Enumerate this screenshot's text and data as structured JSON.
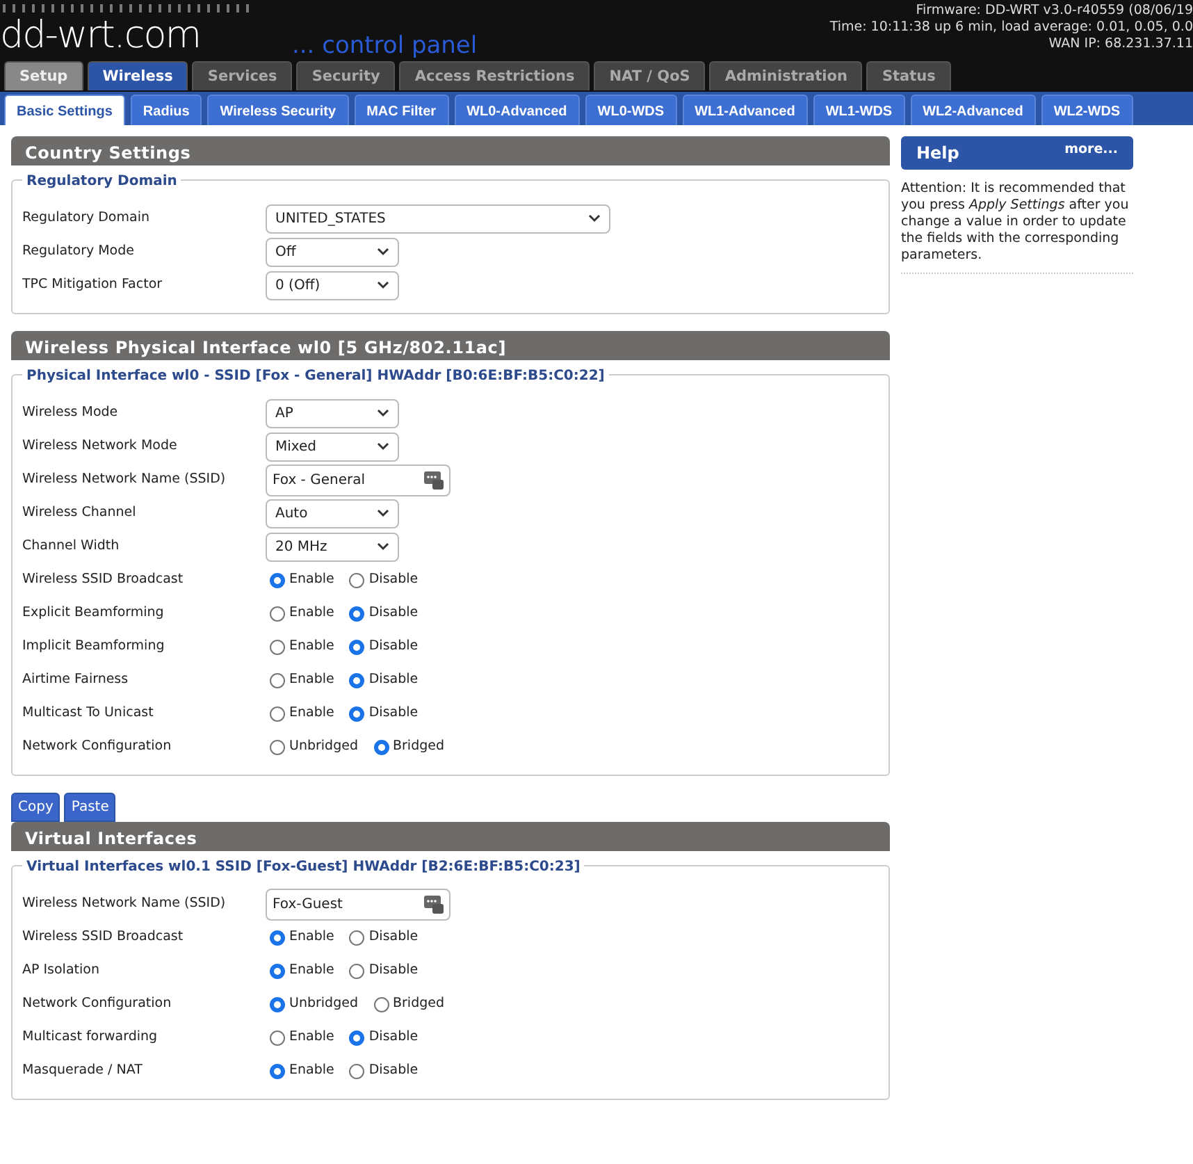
{
  "header": {
    "logo": "dd-wrt.com",
    "subtitle": "... control panel",
    "info": [
      "Firmware: DD-WRT v3.0-r40559 (08/06/19",
      "Time: 10:11:38 up 6 min, load average: 0.01, 0.05, 0.0",
      "WAN IP: 68.231.37.11"
    ]
  },
  "tabs": [
    {
      "label": "Setup",
      "selected": false,
      "hover": true
    },
    {
      "label": "Wireless",
      "selected": true,
      "hover": false
    },
    {
      "label": "Services",
      "selected": false,
      "hover": false
    },
    {
      "label": "Security",
      "selected": false,
      "hover": false
    },
    {
      "label": "Access Restrictions",
      "selected": false,
      "hover": false
    },
    {
      "label": "NAT / QoS",
      "selected": false,
      "hover": false
    },
    {
      "label": "Administration",
      "selected": false,
      "hover": false
    },
    {
      "label": "Status",
      "selected": false,
      "hover": false
    }
  ],
  "subtabs": [
    {
      "label": "Basic Settings",
      "selected": true
    },
    {
      "label": "Radius",
      "selected": false
    },
    {
      "label": "Wireless Security",
      "selected": false
    },
    {
      "label": "MAC Filter",
      "selected": false
    },
    {
      "label": "WL0-Advanced",
      "selected": false
    },
    {
      "label": "WL0-WDS",
      "selected": false
    },
    {
      "label": "WL1-Advanced",
      "selected": false
    },
    {
      "label": "WL1-WDS",
      "selected": false
    },
    {
      "label": "WL2-Advanced",
      "selected": false
    },
    {
      "label": "WL2-WDS",
      "selected": false
    }
  ],
  "sections": [
    {
      "title": "Country Settings",
      "fieldset": {
        "legend": "Regulatory Domain",
        "rows": [
          {
            "label": "Regulatory Domain",
            "kind": "select",
            "value": "UNITED_STATES"
          },
          {
            "label": "Regulatory Mode",
            "kind": "select",
            "value": "Off"
          },
          {
            "label": "TPC Mitigation Factor",
            "kind": "select",
            "value": "0 (Off)"
          }
        ]
      }
    },
    {
      "title": "Wireless Physical Interface wl0 [5 GHz/802.11ac]",
      "buttons": [
        "Copy",
        "Paste"
      ],
      "fieldset": {
        "legend": "Physical Interface wl0 - SSID [Fox - General] HWAddr [B0:6E:BF:B5:C0:22]",
        "rows": [
          {
            "label": "Wireless Mode",
            "kind": "select",
            "value": "AP"
          },
          {
            "label": "Wireless Network Mode",
            "kind": "select",
            "value": "Mixed"
          },
          {
            "label": "Wireless Network Name (SSID)",
            "kind": "text",
            "value": "Fox - General"
          },
          {
            "label": "Wireless Channel",
            "kind": "select",
            "value": "Auto"
          },
          {
            "label": "Channel Width",
            "kind": "select",
            "value": "20 MHz"
          },
          {
            "label": "Wireless SSID Broadcast",
            "kind": "radio",
            "options": [
              {
                "label": "Enable",
                "selected": true
              },
              {
                "label": "Disable",
                "selected": false
              }
            ]
          },
          {
            "label": "Explicit Beamforming",
            "kind": "radio",
            "options": [
              {
                "label": "Enable",
                "selected": false
              },
              {
                "label": "Disable",
                "selected": true
              }
            ]
          },
          {
            "label": "Implicit Beamforming",
            "kind": "radio",
            "options": [
              {
                "label": "Enable",
                "selected": false
              },
              {
                "label": "Disable",
                "selected": true
              }
            ]
          },
          {
            "label": "Airtime Fairness",
            "kind": "radio",
            "options": [
              {
                "label": "Enable",
                "selected": false
              },
              {
                "label": "Disable",
                "selected": true
              }
            ]
          },
          {
            "label": "Multicast To Unicast",
            "kind": "radio",
            "options": [
              {
                "label": "Enable",
                "selected": false
              },
              {
                "label": "Disable",
                "selected": true
              }
            ]
          },
          {
            "label": "Network Configuration",
            "kind": "radio",
            "options": [
              {
                "label": "Unbridged",
                "selected": false
              },
              {
                "label": "Bridged",
                "selected": true
              }
            ]
          }
        ]
      }
    },
    {
      "title": "Virtual Interfaces",
      "fieldset": {
        "legend": "Virtual Interfaces wl0.1 SSID [Fox-Guest] HWAddr [B2:6E:BF:B5:C0:23]",
        "rows": [
          {
            "label": "Wireless Network Name (SSID)",
            "kind": "text",
            "value": "Fox-Guest"
          },
          {
            "label": "Wireless SSID Broadcast",
            "kind": "radio",
            "options": [
              {
                "label": "Enable",
                "selected": true
              },
              {
                "label": "Disable",
                "selected": false
              }
            ]
          },
          {
            "label": "AP Isolation",
            "kind": "radio",
            "options": [
              {
                "label": "Enable",
                "selected": true
              },
              {
                "label": "Disable",
                "selected": false
              }
            ]
          },
          {
            "label": "Network Configuration",
            "kind": "radio",
            "options": [
              {
                "label": "Unbridged",
                "selected": true
              },
              {
                "label": "Bridged",
                "selected": false
              }
            ]
          },
          {
            "label": "Multicast forwarding",
            "kind": "radio",
            "options": [
              {
                "label": "Enable",
                "selected": false
              },
              {
                "label": "Disable",
                "selected": true
              }
            ]
          },
          {
            "label": "Masquerade / NAT",
            "kind": "radio",
            "options": [
              {
                "label": "Enable",
                "selected": true
              },
              {
                "label": "Disable",
                "selected": false
              }
            ]
          }
        ]
      }
    }
  ],
  "help": {
    "title": "Help",
    "more": "more...",
    "text": "Attention: It is recommended that you press *Apply Settings* after you change a value in order to update the fields with the corresponding parameters."
  }
}
